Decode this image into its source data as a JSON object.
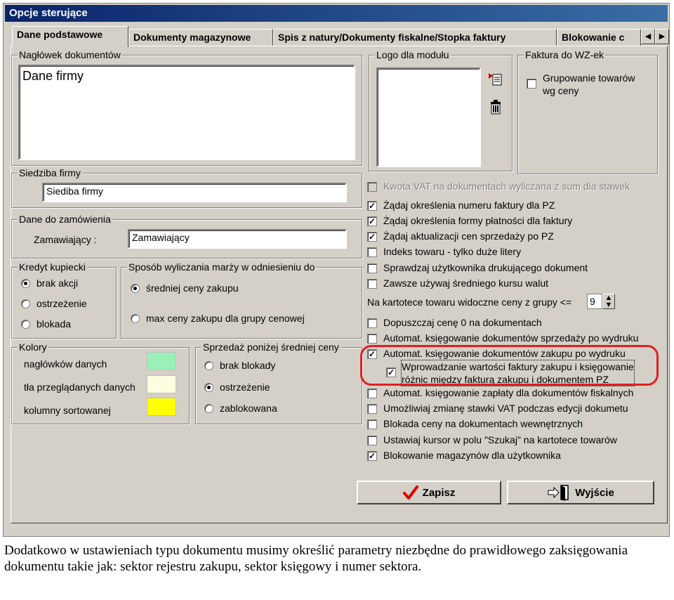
{
  "window": {
    "title": "Opcje sterujące"
  },
  "tabs": [
    "Dane podstawowe",
    "Dokumenty magazynowe",
    "Spis z natury/Dokumenty fiskalne/Stopka faktury",
    "Blokowanie c"
  ],
  "tab_scroll": {
    "left": "◀",
    "right": "▶"
  },
  "header_docs": {
    "title": "Nagłówek dokumentów",
    "value": "Dane firmy"
  },
  "logo": {
    "title": "Logo dla modułu"
  },
  "wz": {
    "title": "Faktura do WZ-ek",
    "group_label": "Grupowanie towarów wg ceny"
  },
  "siedziba": {
    "title": "Siedziba firmy",
    "value": "Siediba firmy"
  },
  "order": {
    "title": "Dane do zamówienia",
    "label": "Zamawiający :",
    "value": "Zamawiający"
  },
  "credit": {
    "title": "Kredyt kupiecki",
    "options": [
      "brak akcji",
      "ostrzeżenie",
      "blokada"
    ]
  },
  "margin": {
    "title": "Sposób wyliczania marży w odniesieniu do",
    "options": [
      "średniej ceny zakupu",
      "max ceny zakupu dla grupy cenowej"
    ]
  },
  "colors": {
    "title": "Kolory",
    "rows": [
      {
        "label": "nagłówków danych",
        "color": "#99f0b8"
      },
      {
        "label": "tła przeglądanych danych",
        "color": "#fffde0"
      },
      {
        "label": "kolumny sortowanej",
        "color": "#ffff00"
      }
    ]
  },
  "below_avg": {
    "title": "Sprzedaż poniżej średniej ceny",
    "options": [
      "brak blokady",
      "ostrzeżenie",
      "zablokowana"
    ]
  },
  "options": {
    "vat_disabled": "Kwota VAT na dokumentach wyliczana z sum dla stawek",
    "items1": [
      {
        "label": "Żądaj określenia numeru faktury dla PZ",
        "checked": true
      },
      {
        "label": "Żądaj określenia formy płatności dla faktury",
        "checked": true
      },
      {
        "label": "Żądaj aktualizacji cen sprzedaży po PZ",
        "checked": true
      },
      {
        "label": "Indeks towaru - tylko duże litery",
        "checked": false
      },
      {
        "label": "Sprawdzaj użytkownika drukującego dokument",
        "checked": false
      },
      {
        "label": "Zawsze używaj średniego kursu walut",
        "checked": false
      }
    ],
    "groups_label": "Na kartotece towaru widoczne ceny z grupy <=",
    "groups_value": "9",
    "items2": [
      {
        "label": "Dopuszczaj cenę 0 na dokumentach",
        "checked": false
      },
      {
        "label": "Automat. księgowanie dokumentów sprzedaży po wydruku",
        "checked": false
      },
      {
        "label": "Automat. księgowanie dokumentów zakupu po wydruku",
        "checked": true
      }
    ],
    "sub_item": {
      "line1": "Wprowadzanie wartości faktury zakupu i księgowanie",
      "line2": "różnic między fakturą zakupu i dokumentem PZ",
      "checked": true
    },
    "items3": [
      {
        "label": "Automat. księgowanie zapłaty dla dokumentów fiskalnych",
        "checked": false
      },
      {
        "label": "Umożliwiaj zmianę stawki VAT podczas edycji dokumetu",
        "checked": false
      },
      {
        "label": "Blokada ceny na dokumentach wewnętrznych",
        "checked": false
      },
      {
        "label": "Ustawiaj kursor w polu \"Szukaj\" na kartotece towarów",
        "checked": false
      },
      {
        "label": "Blokowanie magazynów dla użytkownika",
        "checked": true
      }
    ]
  },
  "buttons": {
    "save": "Zapisz",
    "exit": "Wyjście"
  },
  "caption": "Dodatkowo w ustawieniach typu dokumentu musimy określić parametry niezbędne do prawidłowego zaksięgowania dokumentu takie jak: sektor rejestru zakupu, sektor księgowy i numer sektora.",
  "icons": {
    "add": "add-logo-icon",
    "delete": "trash-icon",
    "save": "checkmark-icon",
    "exit": "exit-door-icon"
  }
}
